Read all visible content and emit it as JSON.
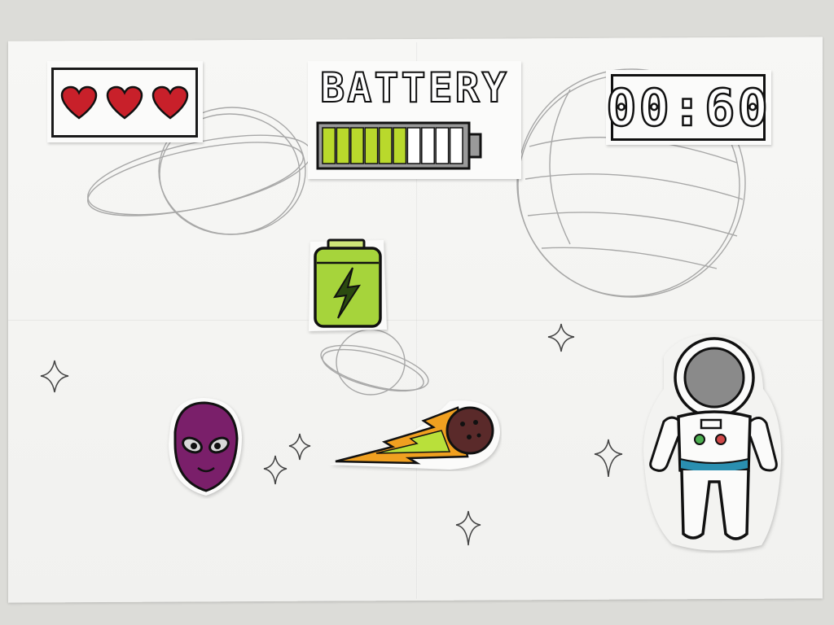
{
  "hud": {
    "lives": {
      "current": 3,
      "max": 3
    },
    "battery": {
      "title": "BATTERY",
      "segments_total": 10,
      "segments_filled": 6
    },
    "timer": {
      "value": "00:60"
    }
  },
  "colors": {
    "heart": "#c8202a",
    "battery_fill": "#b9d92c",
    "battery_pickup": "#9ed23c",
    "alien": "#7a1f6a",
    "fireball_flame": "#f0a020",
    "astronaut_stripe": "#2a8fb0",
    "ink": "#111111"
  },
  "sprites": [
    {
      "name": "battery-pickup",
      "icon": "battery-bolt-icon"
    },
    {
      "name": "alien",
      "icon": "alien-head-icon"
    },
    {
      "name": "comet",
      "icon": "fireball-icon"
    },
    {
      "name": "astronaut",
      "icon": "astronaut-icon"
    }
  ],
  "decorations": [
    "planet-sketch",
    "ringed-planet-sketch",
    "sparkle-stars"
  ]
}
